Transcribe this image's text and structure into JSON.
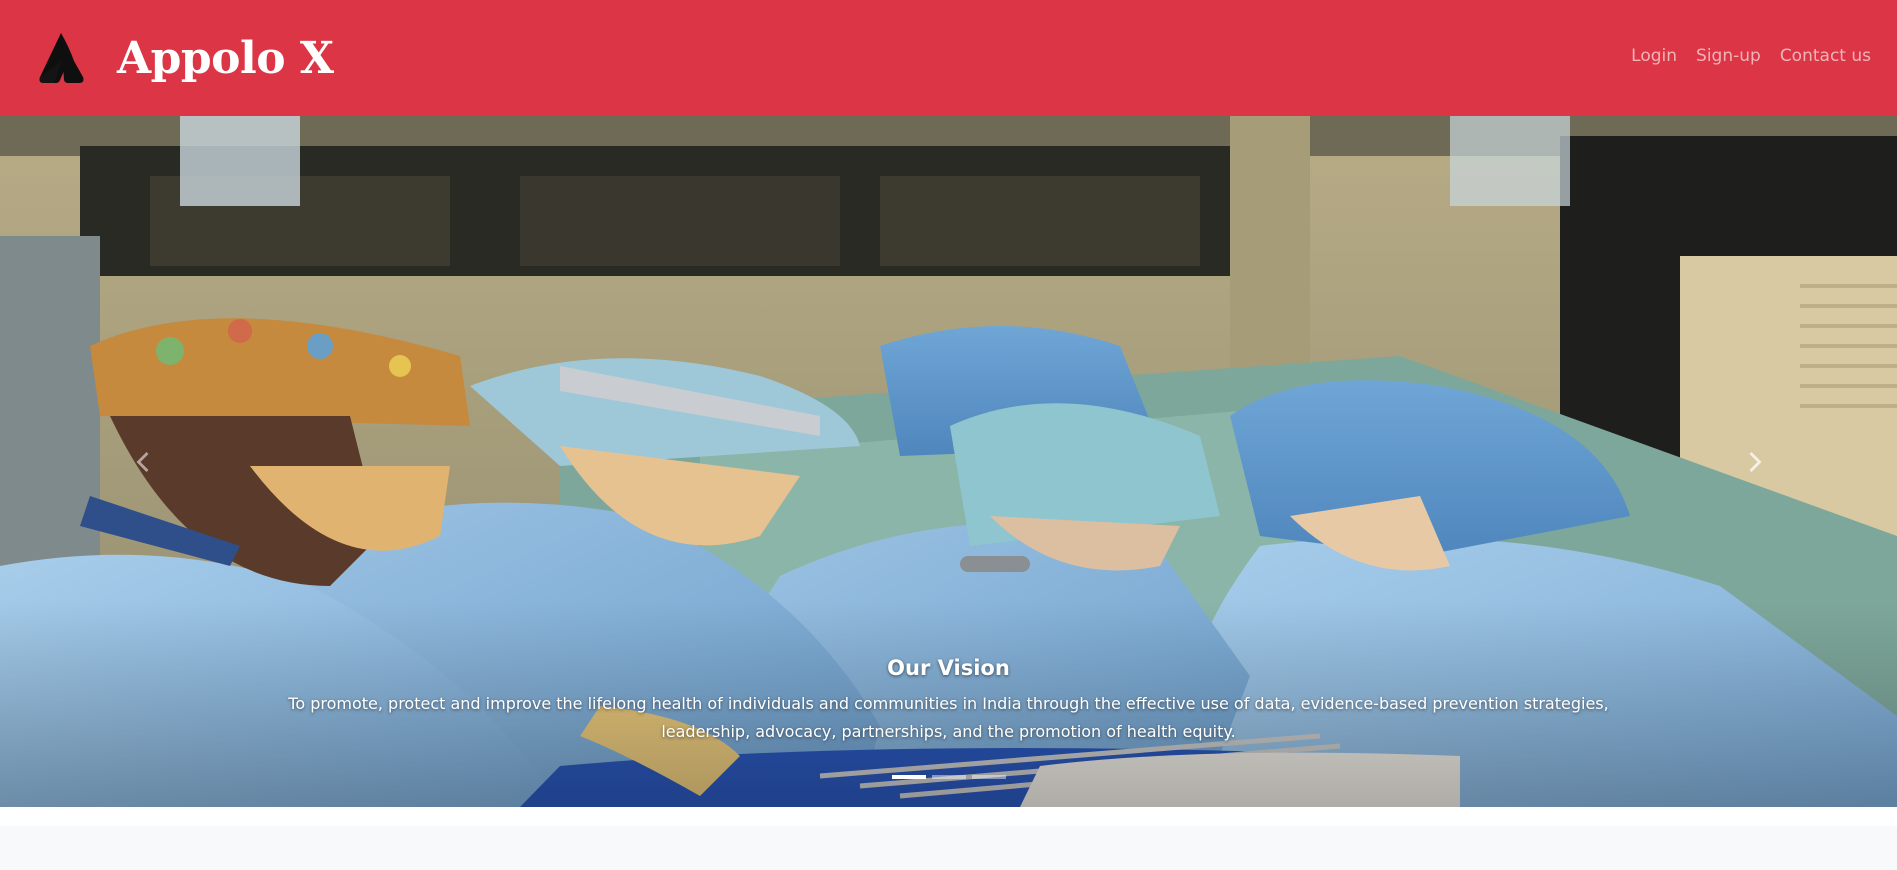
{
  "brand": {
    "name": "Appolo X",
    "logo_icon": "atlassian-style-a-logo-icon"
  },
  "nav": {
    "items": [
      {
        "label": "Login"
      },
      {
        "label": "Sign-up"
      },
      {
        "label": "Contact us"
      }
    ]
  },
  "carousel": {
    "slide_image": "surgeons-operating-room-photo",
    "caption": {
      "title": "Our Vision",
      "text": "To promote, protect and improve the lifelong health of individuals and communities in India through the effective use of data, evidence-based prevention strategies, leadership, advocacy, partnerships, and the promotion of health equity."
    },
    "prev_icon": "chevron-left-icon",
    "next_icon": "chevron-right-icon",
    "slide_count": 3,
    "active_slide": 1
  },
  "colors": {
    "navbar_bg": "#dc3545",
    "brand_text": "#ffffff",
    "nav_link": "rgba(255,255,255,0.62)",
    "section_bg": "#f8f9fa"
  }
}
